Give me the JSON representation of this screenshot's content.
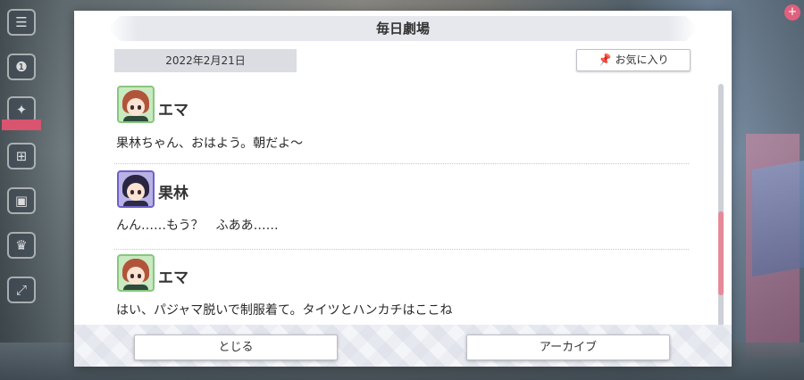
{
  "modal": {
    "title": "毎日劇場",
    "date": "2022年2月21日",
    "favorite_label": "お気に入り",
    "entries": [
      {
        "speaker": "エマ",
        "line": "果林ちゃん、おはよう。朝だよ〜",
        "avatar": "ema-avatar"
      },
      {
        "speaker": "果林",
        "line": "んん……もう？　ふああ……",
        "avatar": "karin-avatar"
      },
      {
        "speaker": "エマ",
        "line": "はい、パジャマ脱いで制服着て。タイツとハンカチはここね",
        "avatar": "ema-avatar"
      }
    ],
    "close_label": "とじる",
    "archive_label": "アーカイブ"
  },
  "colors": {
    "scroll_thumb": "#e58a98",
    "ema_frame": "#86c780",
    "karin_frame": "#6f60c7"
  },
  "icons": [
    "menu-icon",
    "chat-icon",
    "event-icon",
    "gift-icon",
    "screen-icon",
    "trophy-icon",
    "fullscreen-icon",
    "pin-icon"
  ]
}
